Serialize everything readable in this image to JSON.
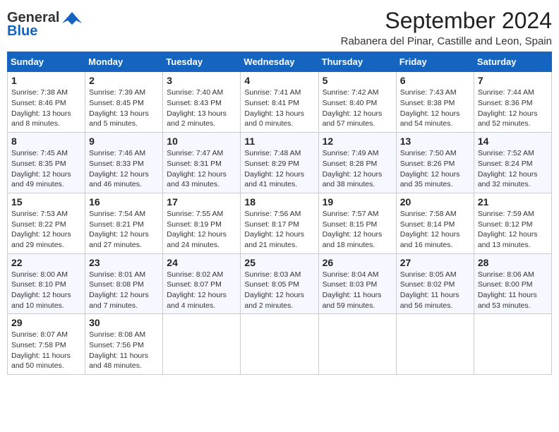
{
  "header": {
    "logo_line1": "General",
    "logo_line2": "Blue",
    "title": "September 2024",
    "subtitle": "Rabanera del Pinar, Castille and Leon, Spain"
  },
  "days_of_week": [
    "Sunday",
    "Monday",
    "Tuesday",
    "Wednesday",
    "Thursday",
    "Friday",
    "Saturday"
  ],
  "weeks": [
    [
      {
        "day": "1",
        "sunrise": "Sunrise: 7:38 AM",
        "sunset": "Sunset: 8:46 PM",
        "daylight": "Daylight: 13 hours and 8 minutes."
      },
      {
        "day": "2",
        "sunrise": "Sunrise: 7:39 AM",
        "sunset": "Sunset: 8:45 PM",
        "daylight": "Daylight: 13 hours and 5 minutes."
      },
      {
        "day": "3",
        "sunrise": "Sunrise: 7:40 AM",
        "sunset": "Sunset: 8:43 PM",
        "daylight": "Daylight: 13 hours and 2 minutes."
      },
      {
        "day": "4",
        "sunrise": "Sunrise: 7:41 AM",
        "sunset": "Sunset: 8:41 PM",
        "daylight": "Daylight: 13 hours and 0 minutes."
      },
      {
        "day": "5",
        "sunrise": "Sunrise: 7:42 AM",
        "sunset": "Sunset: 8:40 PM",
        "daylight": "Daylight: 12 hours and 57 minutes."
      },
      {
        "day": "6",
        "sunrise": "Sunrise: 7:43 AM",
        "sunset": "Sunset: 8:38 PM",
        "daylight": "Daylight: 12 hours and 54 minutes."
      },
      {
        "day": "7",
        "sunrise": "Sunrise: 7:44 AM",
        "sunset": "Sunset: 8:36 PM",
        "daylight": "Daylight: 12 hours and 52 minutes."
      }
    ],
    [
      {
        "day": "8",
        "sunrise": "Sunrise: 7:45 AM",
        "sunset": "Sunset: 8:35 PM",
        "daylight": "Daylight: 12 hours and 49 minutes."
      },
      {
        "day": "9",
        "sunrise": "Sunrise: 7:46 AM",
        "sunset": "Sunset: 8:33 PM",
        "daylight": "Daylight: 12 hours and 46 minutes."
      },
      {
        "day": "10",
        "sunrise": "Sunrise: 7:47 AM",
        "sunset": "Sunset: 8:31 PM",
        "daylight": "Daylight: 12 hours and 43 minutes."
      },
      {
        "day": "11",
        "sunrise": "Sunrise: 7:48 AM",
        "sunset": "Sunset: 8:29 PM",
        "daylight": "Daylight: 12 hours and 41 minutes."
      },
      {
        "day": "12",
        "sunrise": "Sunrise: 7:49 AM",
        "sunset": "Sunset: 8:28 PM",
        "daylight": "Daylight: 12 hours and 38 minutes."
      },
      {
        "day": "13",
        "sunrise": "Sunrise: 7:50 AM",
        "sunset": "Sunset: 8:26 PM",
        "daylight": "Daylight: 12 hours and 35 minutes."
      },
      {
        "day": "14",
        "sunrise": "Sunrise: 7:52 AM",
        "sunset": "Sunset: 8:24 PM",
        "daylight": "Daylight: 12 hours and 32 minutes."
      }
    ],
    [
      {
        "day": "15",
        "sunrise": "Sunrise: 7:53 AM",
        "sunset": "Sunset: 8:22 PM",
        "daylight": "Daylight: 12 hours and 29 minutes."
      },
      {
        "day": "16",
        "sunrise": "Sunrise: 7:54 AM",
        "sunset": "Sunset: 8:21 PM",
        "daylight": "Daylight: 12 hours and 27 minutes."
      },
      {
        "day": "17",
        "sunrise": "Sunrise: 7:55 AM",
        "sunset": "Sunset: 8:19 PM",
        "daylight": "Daylight: 12 hours and 24 minutes."
      },
      {
        "day": "18",
        "sunrise": "Sunrise: 7:56 AM",
        "sunset": "Sunset: 8:17 PM",
        "daylight": "Daylight: 12 hours and 21 minutes."
      },
      {
        "day": "19",
        "sunrise": "Sunrise: 7:57 AM",
        "sunset": "Sunset: 8:15 PM",
        "daylight": "Daylight: 12 hours and 18 minutes."
      },
      {
        "day": "20",
        "sunrise": "Sunrise: 7:58 AM",
        "sunset": "Sunset: 8:14 PM",
        "daylight": "Daylight: 12 hours and 16 minutes."
      },
      {
        "day": "21",
        "sunrise": "Sunrise: 7:59 AM",
        "sunset": "Sunset: 8:12 PM",
        "daylight": "Daylight: 12 hours and 13 minutes."
      }
    ],
    [
      {
        "day": "22",
        "sunrise": "Sunrise: 8:00 AM",
        "sunset": "Sunset: 8:10 PM",
        "daylight": "Daylight: 12 hours and 10 minutes."
      },
      {
        "day": "23",
        "sunrise": "Sunrise: 8:01 AM",
        "sunset": "Sunset: 8:08 PM",
        "daylight": "Daylight: 12 hours and 7 minutes."
      },
      {
        "day": "24",
        "sunrise": "Sunrise: 8:02 AM",
        "sunset": "Sunset: 8:07 PM",
        "daylight": "Daylight: 12 hours and 4 minutes."
      },
      {
        "day": "25",
        "sunrise": "Sunrise: 8:03 AM",
        "sunset": "Sunset: 8:05 PM",
        "daylight": "Daylight: 12 hours and 2 minutes."
      },
      {
        "day": "26",
        "sunrise": "Sunrise: 8:04 AM",
        "sunset": "Sunset: 8:03 PM",
        "daylight": "Daylight: 11 hours and 59 minutes."
      },
      {
        "day": "27",
        "sunrise": "Sunrise: 8:05 AM",
        "sunset": "Sunset: 8:02 PM",
        "daylight": "Daylight: 11 hours and 56 minutes."
      },
      {
        "day": "28",
        "sunrise": "Sunrise: 8:06 AM",
        "sunset": "Sunset: 8:00 PM",
        "daylight": "Daylight: 11 hours and 53 minutes."
      }
    ],
    [
      {
        "day": "29",
        "sunrise": "Sunrise: 8:07 AM",
        "sunset": "Sunset: 7:58 PM",
        "daylight": "Daylight: 11 hours and 50 minutes."
      },
      {
        "day": "30",
        "sunrise": "Sunrise: 8:08 AM",
        "sunset": "Sunset: 7:56 PM",
        "daylight": "Daylight: 11 hours and 48 minutes."
      },
      null,
      null,
      null,
      null,
      null
    ]
  ]
}
